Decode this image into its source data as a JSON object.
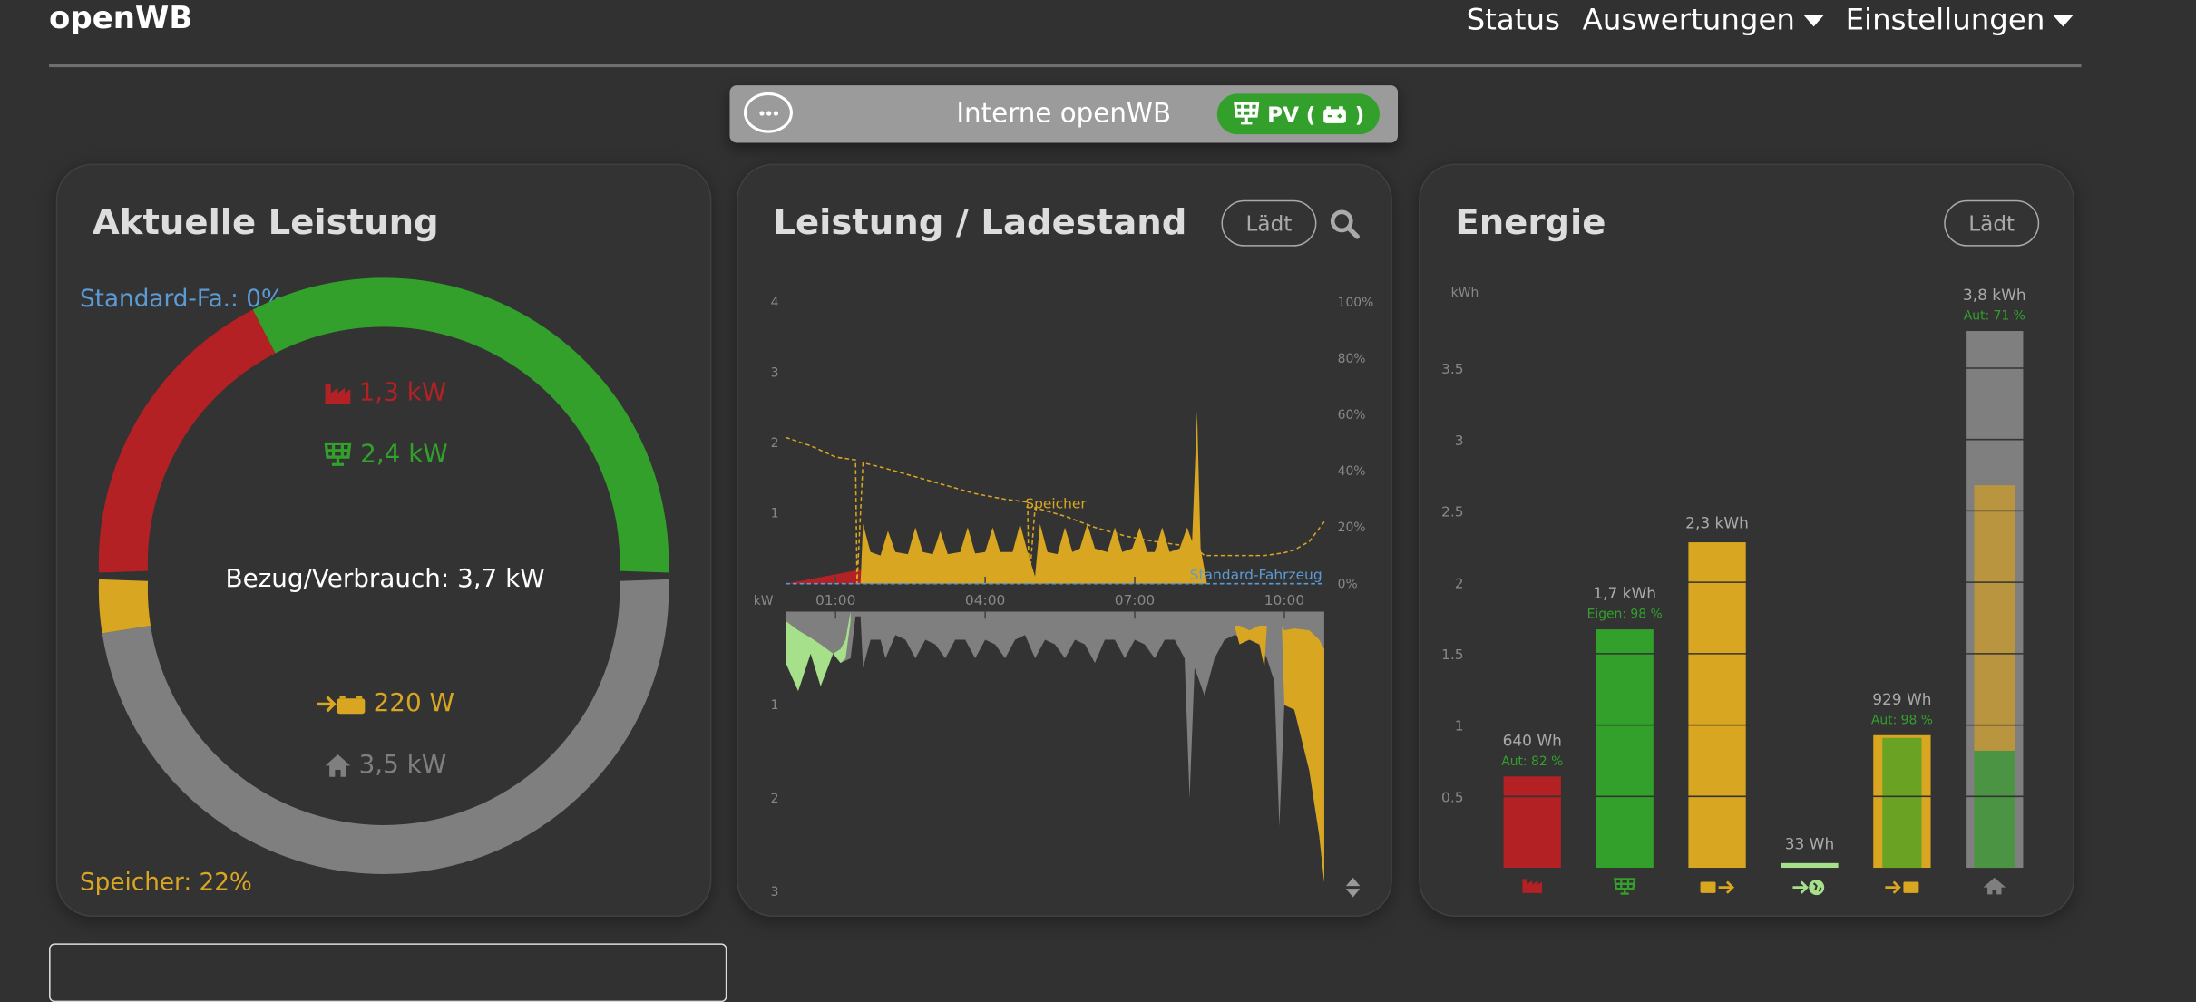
{
  "header": {
    "brand": "openWB",
    "nav": [
      {
        "label": "Status"
      },
      {
        "label": "Auswertungen"
      },
      {
        "label": "Einstellungen"
      }
    ]
  },
  "chargepoint": {
    "name": "Interne openWB",
    "mode_label": "PV",
    "mode_paren_open": "(",
    "mode_paren_close": ")"
  },
  "power_card": {
    "title": "Aktuelle Leistung",
    "vehicle_soc_label": "Standard-Fa.: 0%",
    "battery_soc_label": "Speicher: 22%",
    "grid_value": "1,3 kW",
    "pv_value": "2,4 kW",
    "total_label": "Bezug/Verbrauch: 3,7 kW",
    "battery_value": "220 W",
    "house_value": "3,5 kW"
  },
  "history_card": {
    "title": "Leistung / Ladestand",
    "load_button": "Lädt"
  },
  "energy_card": {
    "title": "Energie",
    "load_button": "Lädt"
  },
  "colors": {
    "grid": "#b32124",
    "pv": "#33a02c",
    "battery": "#d9a621",
    "export": "#a6e08a",
    "house": "#7f7f7f",
    "vehicle": "#5b9bd5"
  },
  "chart_data": [
    {
      "type": "pie",
      "title": "Aktuelle Leistung",
      "sources": [
        {
          "name": "grid",
          "value": 1.3
        },
        {
          "name": "pv",
          "value": 2.4
        }
      ],
      "consumers": [
        {
          "name": "battery",
          "value": 0.22
        },
        {
          "name": "house",
          "value": 3.5
        }
      ],
      "unit": "kW"
    },
    {
      "type": "area",
      "title": "Leistung / Ladestand",
      "ylabel": "kW",
      "x_ticks": [
        "01:00",
        "04:00",
        "07:00",
        "10:00"
      ],
      "x_tick_hours": [
        1,
        4,
        7,
        10
      ],
      "xlim_hours": [
        0,
        10.8
      ],
      "upper_y_ticks": [
        "4",
        "3",
        "2",
        "1"
      ],
      "upper_ylim": [
        0,
        4
      ],
      "soc_ticks": [
        "100%",
        "80%",
        "60%",
        "40%",
        "20%",
        "0%"
      ],
      "lower_y_ticks": [
        "1",
        "2",
        "3"
      ],
      "lower_ylim": [
        0,
        3
      ],
      "series_labels": {
        "battery_soc": "Speicher",
        "vehicle_soc": "Standard-Fahrzeug"
      },
      "grid_import": [
        [
          0,
          0
        ],
        [
          1.5,
          0.2
        ],
        [
          1.52,
          0
        ]
      ],
      "battery_discharge": [
        [
          1.5,
          0
        ],
        [
          1.55,
          0.85
        ],
        [
          1.7,
          0.45
        ],
        [
          1.9,
          0.4
        ],
        [
          2.05,
          0.75
        ],
        [
          2.2,
          0.45
        ],
        [
          2.45,
          0.42
        ],
        [
          2.6,
          0.8
        ],
        [
          2.75,
          0.45
        ],
        [
          2.95,
          0.42
        ],
        [
          3.1,
          0.75
        ],
        [
          3.25,
          0.42
        ],
        [
          3.5,
          0.45
        ],
        [
          3.65,
          0.8
        ],
        [
          3.8,
          0.43
        ],
        [
          4.0,
          0.45
        ],
        [
          4.15,
          0.8
        ],
        [
          4.3,
          0.45
        ],
        [
          4.55,
          0.45
        ],
        [
          4.7,
          0.85
        ],
        [
          4.85,
          0.45
        ],
        [
          5.0,
          0.1
        ],
        [
          5.1,
          0.85
        ],
        [
          5.25,
          0.45
        ],
        [
          5.45,
          0.42
        ],
        [
          5.6,
          0.8
        ],
        [
          5.75,
          0.45
        ],
        [
          5.9,
          0.5
        ],
        [
          6.05,
          0.85
        ],
        [
          6.2,
          0.5
        ],
        [
          6.45,
          0.45
        ],
        [
          6.6,
          0.8
        ],
        [
          6.75,
          0.45
        ],
        [
          6.95,
          0.5
        ],
        [
          7.1,
          0.8
        ],
        [
          7.25,
          0.45
        ],
        [
          7.4,
          0.45
        ],
        [
          7.55,
          0.8
        ],
        [
          7.7,
          0.45
        ],
        [
          7.9,
          0.5
        ],
        [
          8.05,
          0.8
        ],
        [
          8.15,
          0.6
        ],
        [
          8.25,
          2.45
        ],
        [
          8.32,
          0.5
        ],
        [
          8.45,
          0
        ]
      ],
      "battery_soc": [
        [
          0,
          52
        ],
        [
          0.5,
          49
        ],
        [
          1.0,
          45
        ],
        [
          1.4,
          44
        ],
        [
          1.43,
          0
        ],
        [
          1.55,
          43
        ],
        [
          2.0,
          41
        ],
        [
          2.6,
          38
        ],
        [
          3.2,
          35
        ],
        [
          3.8,
          32
        ],
        [
          4.4,
          30
        ],
        [
          4.85,
          29
        ],
        [
          4.88,
          0
        ],
        [
          5.0,
          27
        ],
        [
          5.6,
          24
        ],
        [
          6.2,
          20
        ],
        [
          6.8,
          17
        ],
        [
          7.4,
          15
        ],
        [
          8.2,
          13
        ],
        [
          8.4,
          10
        ],
        [
          9.6,
          10
        ],
        [
          10.0,
          11
        ],
        [
          10.2,
          12
        ],
        [
          10.5,
          15
        ],
        [
          10.8,
          22
        ]
      ],
      "vehicle_soc": [
        [
          0,
          0
        ],
        [
          10.8,
          0
        ]
      ],
      "house": [
        [
          0,
          0.55
        ],
        [
          0.15,
          0.6
        ],
        [
          0.25,
          0.85
        ],
        [
          0.35,
          0.55
        ],
        [
          0.5,
          0.45
        ],
        [
          0.7,
          0.8
        ],
        [
          0.8,
          0.5
        ],
        [
          0.95,
          0.45
        ],
        [
          1.1,
          0.55
        ],
        [
          1.3,
          0.5
        ],
        [
          1.4,
          0.05
        ],
        [
          1.5,
          0.05
        ],
        [
          1.55,
          0.6
        ],
        [
          1.7,
          0.3
        ],
        [
          1.9,
          0.3
        ],
        [
          2.0,
          0.5
        ],
        [
          2.2,
          0.25
        ],
        [
          2.4,
          0.3
        ],
        [
          2.6,
          0.5
        ],
        [
          2.8,
          0.3
        ],
        [
          3.0,
          0.35
        ],
        [
          3.2,
          0.5
        ],
        [
          3.4,
          0.3
        ],
        [
          3.6,
          0.3
        ],
        [
          3.8,
          0.5
        ],
        [
          4.0,
          0.3
        ],
        [
          4.2,
          0.35
        ],
        [
          4.4,
          0.5
        ],
        [
          4.6,
          0.3
        ],
        [
          4.8,
          0.25
        ],
        [
          5.0,
          0.5
        ],
        [
          5.2,
          0.3
        ],
        [
          5.4,
          0.35
        ],
        [
          5.6,
          0.5
        ],
        [
          5.8,
          0.3
        ],
        [
          6.0,
          0.35
        ],
        [
          6.2,
          0.55
        ],
        [
          6.4,
          0.3
        ],
        [
          6.6,
          0.3
        ],
        [
          6.8,
          0.5
        ],
        [
          7.0,
          0.3
        ],
        [
          7.2,
          0.35
        ],
        [
          7.4,
          0.5
        ],
        [
          7.6,
          0.3
        ],
        [
          7.8,
          0.3
        ],
        [
          8.0,
          0.5
        ],
        [
          8.1,
          2.0
        ],
        [
          8.2,
          0.6
        ],
        [
          8.4,
          0.9
        ],
        [
          8.6,
          0.5
        ],
        [
          8.8,
          0.3
        ],
        [
          9.0,
          0.25
        ],
        [
          9.3,
          0.3
        ],
        [
          9.5,
          0.35
        ],
        [
          9.65,
          0.5
        ],
        [
          9.8,
          0.75
        ],
        [
          9.9,
          2.3
        ],
        [
          10.0,
          1.0
        ],
        [
          10.2,
          1.05
        ],
        [
          10.5,
          1.7
        ],
        [
          10.7,
          2.4
        ],
        [
          10.8,
          2.9
        ]
      ],
      "pv_band": [
        [
          0,
          0.1,
          0.55
        ],
        [
          0.25,
          0.2,
          0.85
        ],
        [
          0.5,
          0.28,
          0.45
        ],
        [
          0.7,
          0.35,
          0.8
        ],
        [
          0.95,
          0.45,
          0.45
        ],
        [
          1.1,
          0.4,
          0.55
        ],
        [
          1.2,
          0.3,
          0.5
        ],
        [
          1.3,
          0.0,
          0.1
        ]
      ],
      "battery_charge_band": [
        [
          9.0,
          0.15,
          0.15
        ],
        [
          9.1,
          0.15,
          0.35
        ],
        [
          9.3,
          0.2,
          0.3
        ],
        [
          9.5,
          0.15,
          0.35
        ],
        [
          9.6,
          0.15,
          0.6
        ],
        [
          9.65,
          0.15,
          0.15
        ],
        [
          9.95,
          0.15,
          0.15
        ],
        [
          10.0,
          0.2,
          1.0
        ],
        [
          10.2,
          0.18,
          1.05
        ],
        [
          10.5,
          0.2,
          1.7
        ],
        [
          10.7,
          0.3,
          2.4
        ],
        [
          10.8,
          0.4,
          2.9
        ]
      ]
    },
    {
      "type": "bar",
      "title": "Energie",
      "ylabel": "kWh",
      "y_ticks": [
        "3.5",
        "3",
        "2.5",
        "2",
        "1.5",
        "1",
        "0.5"
      ],
      "ylim": [
        0,
        4
      ],
      "bars": [
        {
          "name": "grid",
          "value": 0.64,
          "label": "640 Wh",
          "sub": "Aut: 82 %",
          "icon": "factory-icon"
        },
        {
          "name": "pv",
          "value": 1.67,
          "label": "1,7 kWh",
          "sub": "Eigen: 98 %",
          "icon": "solar-panel-icon"
        },
        {
          "name": "battery-discharge",
          "value": 2.28,
          "label": "2,3 kWh",
          "sub": "",
          "icon": "battery-out-icon"
        },
        {
          "name": "export",
          "value": 0.033,
          "label": "33 Wh",
          "sub": "",
          "icon": "export-globe-icon"
        },
        {
          "name": "battery-charge",
          "value": 0.929,
          "label": "929 Wh",
          "sub": "Aut: 98 %",
          "icon": "battery-in-icon",
          "inner": [
            {
              "name": "pv-share",
              "value": 0.91
            }
          ]
        },
        {
          "name": "house",
          "value": 3.76,
          "label": "3,8 kWh",
          "sub": "Aut: 71 %",
          "icon": "house-icon",
          "inner": [
            {
              "name": "battery-share",
              "value": 2.68
            },
            {
              "name": "pv-share",
              "value": 0.82
            }
          ]
        }
      ]
    }
  ]
}
